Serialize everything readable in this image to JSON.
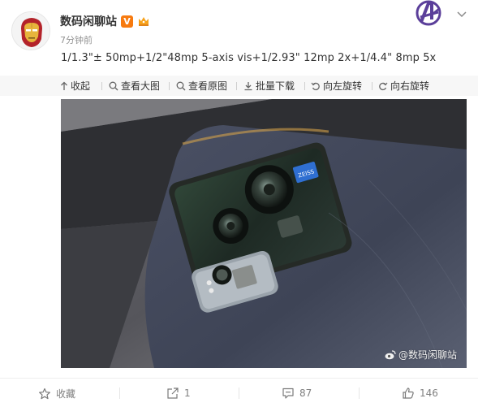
{
  "post": {
    "username": "数码闲聊站",
    "vip_badge": "V",
    "timestamp": "7分钟前",
    "text": "1/1.3\"± 50mp+1/2\"48mp 5-axis vis+1/2.93\" 12mp 2x+1/4.4\" 8mp 5x"
  },
  "toolbar": {
    "collapse": "收起",
    "view_large": "查看大图",
    "view_original": "查看原图",
    "batch_download": "批量下载",
    "rotate_left": "向左旋转",
    "rotate_right": "向右旋转"
  },
  "image": {
    "watermark": "@数码闲聊站",
    "lens_brand": "ZEISS"
  },
  "actions": {
    "favorite": "收藏",
    "repost_count": "1",
    "comment_count": "87",
    "like_count": "146"
  },
  "icons": {
    "avatar": "iron-man-avatar",
    "vip": "vip-badge-icon",
    "crown": "crown-icon",
    "logo": "avengers-logo-icon",
    "menu": "chevron-down-icon"
  },
  "colors": {
    "accent_orange": "#f77a0f",
    "toolbar_bg": "#f7f7f7",
    "action_text": "#808080",
    "text": "#333333",
    "timestamp": "#939393"
  }
}
